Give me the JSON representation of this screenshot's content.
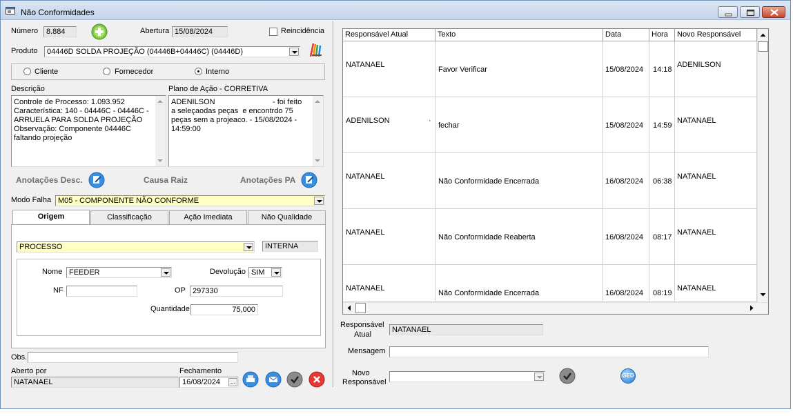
{
  "window": {
    "title": "Não Conformidades"
  },
  "header": {
    "numero_label": "Número",
    "numero_value": "8.884",
    "abertura_label": "Abertura",
    "abertura_value": "15/08/2024",
    "reincidencia_label": "Reincidência",
    "produto_label": "Produto",
    "produto_value": "04446D   SOLDA PROJEÇÃO (04446B+04446C) (04446D)"
  },
  "tipo": {
    "options": [
      "Cliente",
      "Fornecedor",
      "Interno"
    ],
    "selected": "Interno"
  },
  "descricao": {
    "label": "Descrição",
    "text": "Controle de Processo: 1.093.952\nCaracterística: 140 - 04446C - 04446C -\nARRUELA PARA SOLDA PROJEÇÃO\nObservação: Componente 04446C\nfaltando projeção"
  },
  "plano": {
    "label": "Plano de Ação - CORRETIVA",
    "line1_left": "ADENILSON",
    "line1_right": "- foi feito",
    "rest": "a seleçaodas peças  e encontrdo 75\npeças sem a projeaco. - 15/08/2024 -\n14:59:00"
  },
  "links": {
    "anotacoes_desc": "Anotações Desc.",
    "causa_raiz": "Causa Raiz",
    "anotacoes_pa": "Anotações PA"
  },
  "modo_falha": {
    "label": "Modo Falha",
    "value": "M05 - COMPONENTE NÃO CONFORME"
  },
  "tabs": [
    "Origem",
    "Classificação",
    "Ação Imediata",
    "Não Qualidade"
  ],
  "origem": {
    "tipo_value": "PROCESSO",
    "tipo_info": "INTERNA",
    "nome_label": "Nome",
    "nome_value": "FEEDER",
    "devolucao_label": "Devolução",
    "devolucao_value": "SIM",
    "nf_label": "NF",
    "nf_value": "",
    "op_label": "OP",
    "op_value": "297330",
    "quantidade_label": "Quantidade",
    "quantidade_value": "75,000"
  },
  "footer": {
    "obs_label": "Obs.",
    "obs_value": "",
    "aberto_por_label": "Aberto por",
    "aberto_por_value": "NATANAEL",
    "fechamento_label": "Fechamento",
    "fechamento_value": "16/08/2024",
    "date_button": "..."
  },
  "grid": {
    "columns": [
      "Responsável Atual",
      "Texto",
      "Data",
      "Hora",
      "Novo Responsável"
    ],
    "rows": [
      {
        "responsavel": "NATANAEL",
        "texto": "Favor Verificar",
        "data": "15/08/2024",
        "hora": "14:18",
        "novo": "ADENILSON",
        "extra": ""
      },
      {
        "responsavel": "ADENILSON",
        "texto": "fechar",
        "data": "15/08/2024",
        "hora": "14:59",
        "novo": "NATANAEL",
        "extra": "·"
      },
      {
        "responsavel": "NATANAEL",
        "texto": "Não Conformidade Encerrada",
        "data": "16/08/2024",
        "hora": "06:38",
        "novo": "NATANAEL",
        "extra": ""
      },
      {
        "responsavel": "NATANAEL",
        "texto": "Não Conformidade Reaberta",
        "data": "16/08/2024",
        "hora": "08:17",
        "novo": "NATANAEL",
        "extra": ""
      },
      {
        "responsavel": "NATANAEL",
        "texto": "Não Conformidade Encerrada",
        "data": "16/08/2024",
        "hora": "08:19",
        "novo": "NATANAEL",
        "extra": ""
      }
    ]
  },
  "right_form": {
    "resp_atual_label_1": "Responsável",
    "resp_atual_label_2": "Atual",
    "resp_atual_value": "NATANAEL",
    "mensagem_label": "Mensagem",
    "mensagem_value": "",
    "novo_resp_label_1": "Novo",
    "novo_resp_label_2": "Responsável",
    "novo_resp_value": "",
    "ged_label": "GED"
  },
  "colors": {
    "field_yellow": "#ffffc4",
    "titlebar": "#c4d4ea",
    "blue_button": "#2b7fd0"
  }
}
